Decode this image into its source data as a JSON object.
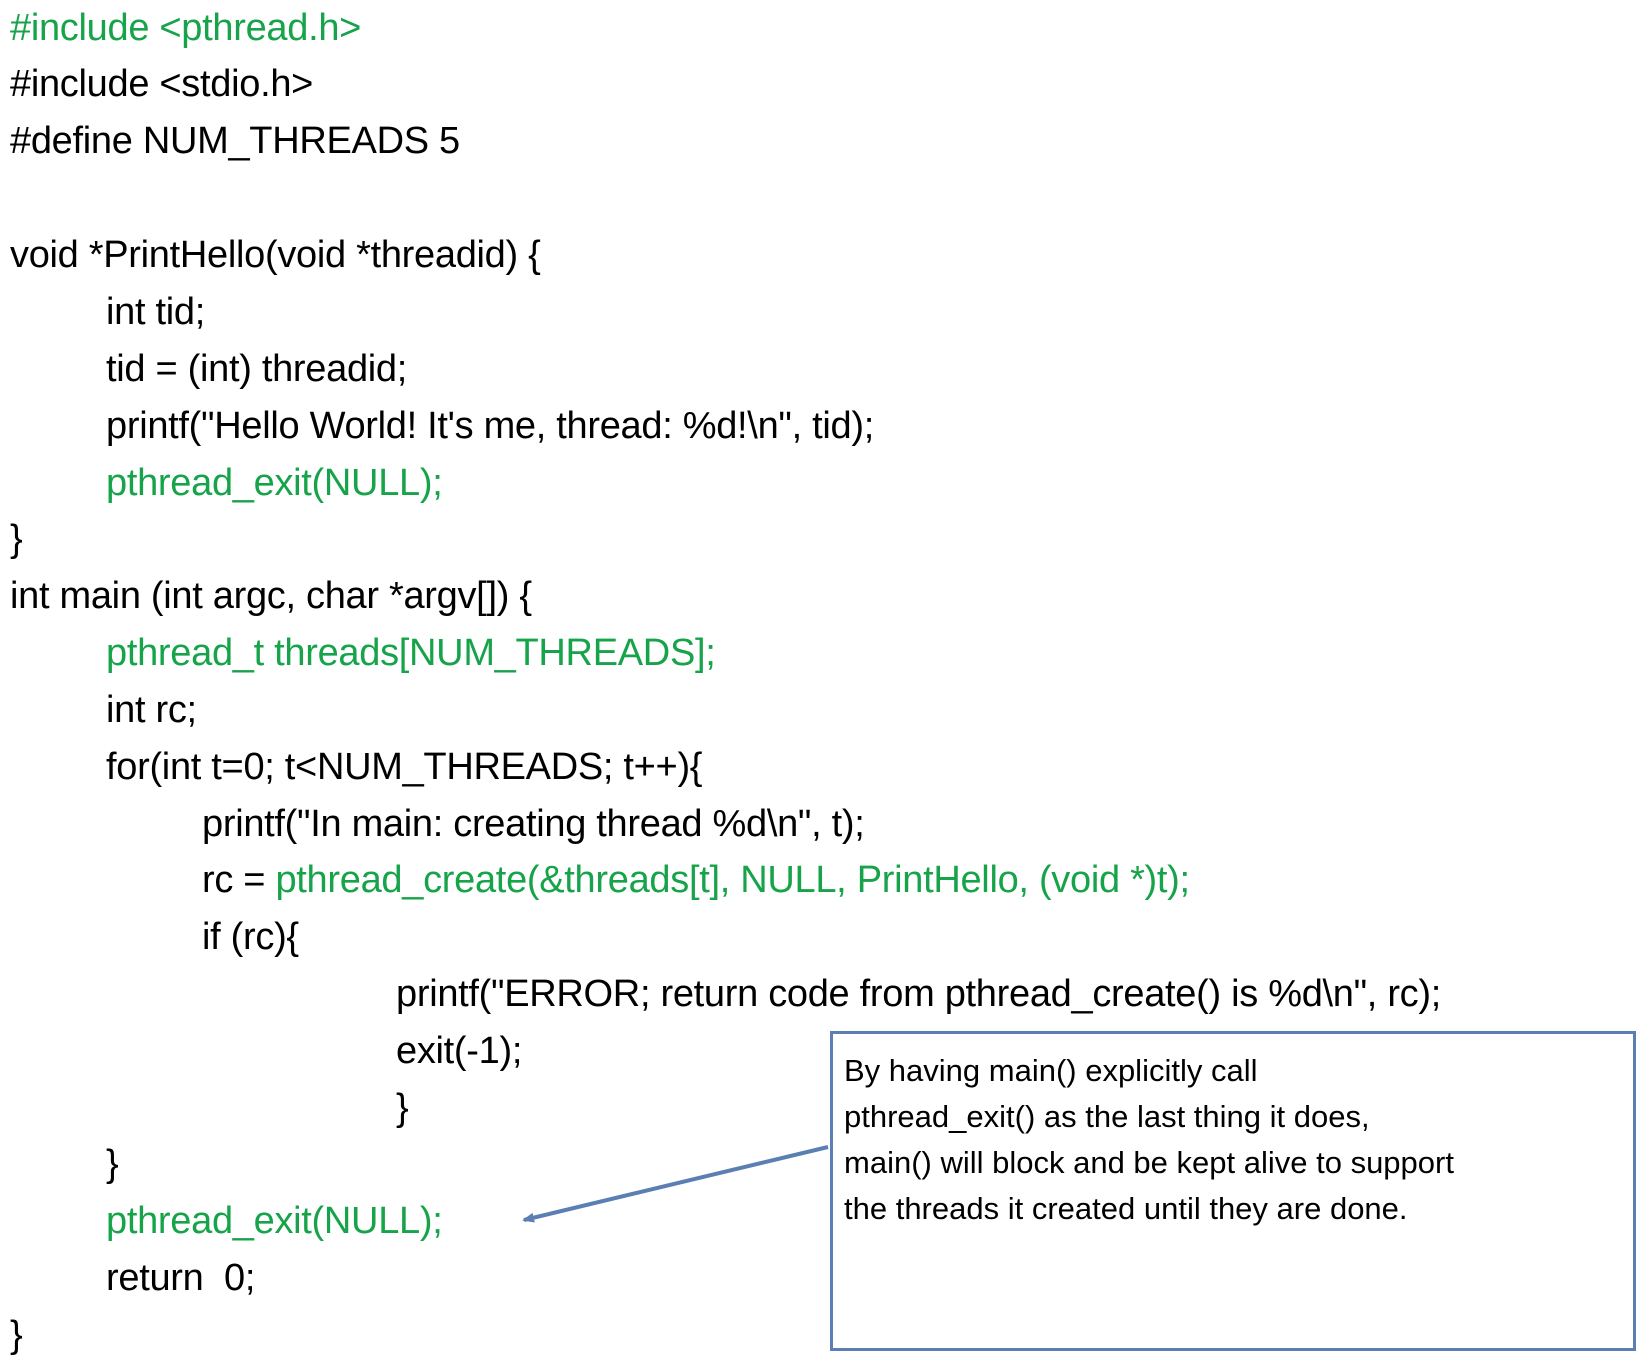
{
  "code_lines": [
    {
      "segments": [
        {
          "text": "#include <pthread.h>",
          "color": "green"
        }
      ]
    },
    {
      "segments": [
        {
          "text": "#include <stdio.h>",
          "color": "black"
        }
      ]
    },
    {
      "segments": [
        {
          "text": "#define NUM_THREADS 5",
          "color": "black"
        }
      ]
    },
    {
      "segments": [
        {
          "text": "",
          "color": "black"
        }
      ]
    },
    {
      "segments": [
        {
          "text": "void *PrintHello(void *threadid) {",
          "color": "black"
        }
      ]
    },
    {
      "segments": [
        {
          "text": "int tid;",
          "color": "black"
        }
      ]
    },
    {
      "segments": [
        {
          "text": "tid = (int) threadid;",
          "color": "black"
        }
      ]
    },
    {
      "segments": [
        {
          "text": "printf(\"Hello World! It's me, thread: %d!\\n\", tid);",
          "color": "black"
        }
      ]
    },
    {
      "segments": [
        {
          "text": "pthread_exit(NULL);",
          "color": "green"
        }
      ]
    },
    {
      "segments": [
        {
          "text": "}",
          "color": "black"
        }
      ]
    },
    {
      "segments": [
        {
          "text": "int main (int argc, char *argv[]) {",
          "color": "black"
        }
      ]
    },
    {
      "segments": [
        {
          "text": "pthread_t threads[NUM_THREADS];",
          "color": "green"
        }
      ]
    },
    {
      "segments": [
        {
          "text": "int rc;",
          "color": "black"
        }
      ]
    },
    {
      "segments": [
        {
          "text": "for(int t=0; t<NUM_THREADS; t++){",
          "color": "black"
        }
      ]
    },
    {
      "segments": [
        {
          "text": "printf(\"In main: creating thread %d\\n\", t);",
          "color": "black"
        }
      ]
    },
    {
      "segments": [
        {
          "text": "rc = ",
          "color": "black"
        },
        {
          "text": "pthread_create(&threads[t], NULL, PrintHello, (void *)t);",
          "color": "green"
        }
      ]
    },
    {
      "segments": [
        {
          "text": "if (rc){",
          "color": "black"
        }
      ]
    },
    {
      "segments": [
        {
          "text": "printf(\"ERROR; return code from pthread_create() is %d\\n\", rc);",
          "color": "black"
        }
      ]
    },
    {
      "segments": [
        {
          "text": "exit(-1);",
          "color": "black"
        }
      ]
    },
    {
      "segments": [
        {
          "text": "}",
          "color": "black"
        }
      ]
    },
    {
      "segments": [
        {
          "text": "}",
          "color": "black"
        }
      ]
    },
    {
      "segments": [
        {
          "text": "pthread_exit(NULL);",
          "color": "green"
        }
      ]
    },
    {
      "segments": [
        {
          "text": "return  0;",
          "color": "black"
        }
      ]
    },
    {
      "segments": [
        {
          "text": "}",
          "color": "black"
        }
      ]
    }
  ],
  "callout": {
    "lines": [
      "By having main() explicitly call",
      "pthread_exit() as the last thing it does,",
      "main() will block and be kept alive to support",
      "the threads it created until they are done."
    ],
    "border_color": "#5b7fb3"
  },
  "colors": {
    "green": "#16a34a",
    "black": "#000000",
    "arrow": "#5b7fb3"
  }
}
